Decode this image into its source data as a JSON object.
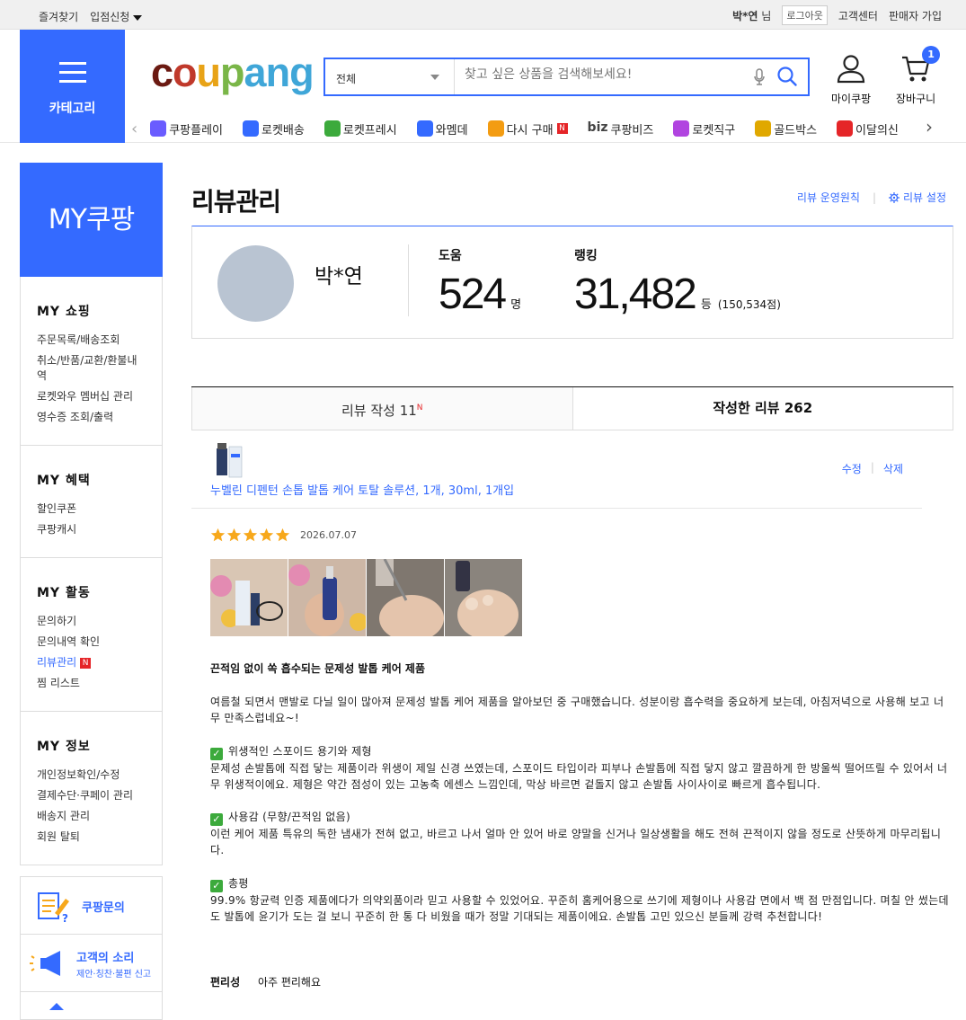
{
  "topbar": {
    "favorites": "즐겨찾기",
    "seller_apply": "입점신청",
    "user_name": "박*연",
    "user_suffix": "님",
    "logout": "로그아웃",
    "customer_center": "고객센터",
    "seller_join": "판매자 가입"
  },
  "header": {
    "category_label": "카테고리",
    "logo": "coupang",
    "search_scope": "전체",
    "search_placeholder": "찾고 싶은 상품을 검색해보세요!",
    "my_coupang": "마이쿠팡",
    "cart": "장바구니",
    "cart_count": "1"
  },
  "quick_links": [
    {
      "label": "쿠팡플레이",
      "color": "#6a5cff"
    },
    {
      "label": "로켓배송",
      "color": "#346aff"
    },
    {
      "label": "로켓프레시",
      "color": "#3caa3c"
    },
    {
      "label": "와멤데",
      "color": "#346aff"
    },
    {
      "label": "다시 구매",
      "color": "#f39c12"
    },
    {
      "label": "쿠팡비즈",
      "color": "#444444"
    },
    {
      "label": "로켓직구",
      "color": "#b144e0"
    },
    {
      "label": "골드박스",
      "color": "#e0a800"
    },
    {
      "label": "이달의신",
      "color": "#e52528"
    }
  ],
  "quick_biz_prefix": "biz",
  "sidebar": {
    "title": "MY쿠팡",
    "sections": [
      {
        "title": "MY 쇼핑",
        "items": [
          "주문목록/배송조회",
          "취소/반품/교환/환불내역",
          "로켓와우 멤버십 관리",
          "영수증 조회/출력"
        ]
      },
      {
        "title": "MY 혜택",
        "items": [
          "할인쿠폰",
          "쿠팡캐시"
        ]
      },
      {
        "title": "MY 활동",
        "items": [
          "문의하기",
          "문의내역 확인",
          "리뷰관리",
          "찜 리스트"
        ]
      },
      {
        "title": "MY 정보",
        "items": [
          "개인정보확인/수정",
          "결제수단·쿠페이 관리",
          "배송지 관리",
          "회원 탈퇴"
        ]
      }
    ],
    "new_badge": "N",
    "promo": {
      "inquiry": "쿠팡문의",
      "voice_title": "고객의 소리",
      "voice_sub": "제안·칭찬·불편 신고"
    }
  },
  "main": {
    "title": "리뷰관리",
    "policy_link": "리뷰 운영원칙",
    "settings_link": "리뷰 설정",
    "profile": {
      "name": "박*연",
      "help_label": "도움",
      "help_value": "524",
      "help_unit": "명",
      "rank_label": "랭킹",
      "rank_value": "31,482",
      "rank_unit": "등",
      "rank_score": "(150,534점)"
    },
    "tabs": {
      "write_label": "리뷰 작성",
      "write_count": "11",
      "write_new": "N",
      "written_label": "작성한 리뷰",
      "written_count": "262"
    },
    "review": {
      "product_name": "누벨린 디펜턴 손톱 발톱 케어 토탈 솔루션, 1개, 30ml, 1개입",
      "edit": "수정",
      "delete": "삭제",
      "rating": 5,
      "date": "2026.07.07",
      "headline": "끈적임 없이 쏙 흡수되는 문제성 발톱 케어 제품",
      "intro": "여름철 되면서 맨발로 다닐 일이 많아져 문제성 발톱 케어 제품을 알아보던 중 구매했습니다. 성분이랑 흡수력을 중요하게 보는데, 아침저녁으로 사용해 보고 너무 만족스럽네요~!",
      "points": [
        {
          "title": "위생적인 스포이드 용기와 제형",
          "body": "문제성 손발톱에 직접 닿는 제품이라 위생이 제일 신경 쓰였는데, 스포이드 타입이라 피부나 손발톱에 직접 닿지 않고 깔끔하게 한 방울씩 떨어뜨릴 수 있어서 너무 위생적이에요. 제형은 약간 점성이 있는 고농축 에센스 느낌인데, 막상 바르면 겉돌지 않고 손발톱 사이사이로 빠르게 흡수됩니다."
        },
        {
          "title": "사용감 (무향/끈적임 없음)",
          "body": "이런 케어 제품 특유의 독한 냄새가 전혀 없고, 바르고 나서 얼마 안 있어 바로 양말을 신거나 일상생활을 해도 전혀 끈적이지 않을 정도로 산뜻하게 마무리됩니다."
        },
        {
          "title": "총평",
          "body": "99.9% 항균력 인증 제품에다가 의약외품이라 믿고 사용할 수 있었어요. 꾸준히 홈케어용으로 쓰기에 제형이나 사용감 면에서 백 점 만점입니다. 며칠 안 썼는데도 발톱에 윤기가 도는 걸 보니 꾸준히 한 통 다 비웠을 때가 정말 기대되는 제품이에요. 손발톱 고민 있으신 분들께 강력 추천합니다!"
        }
      ],
      "convenience_label": "편리성",
      "convenience_value": "아주 편리해요"
    }
  },
  "colors": {
    "brand": "#346aff",
    "star": "#f7a81b",
    "badge": "#e52528"
  }
}
